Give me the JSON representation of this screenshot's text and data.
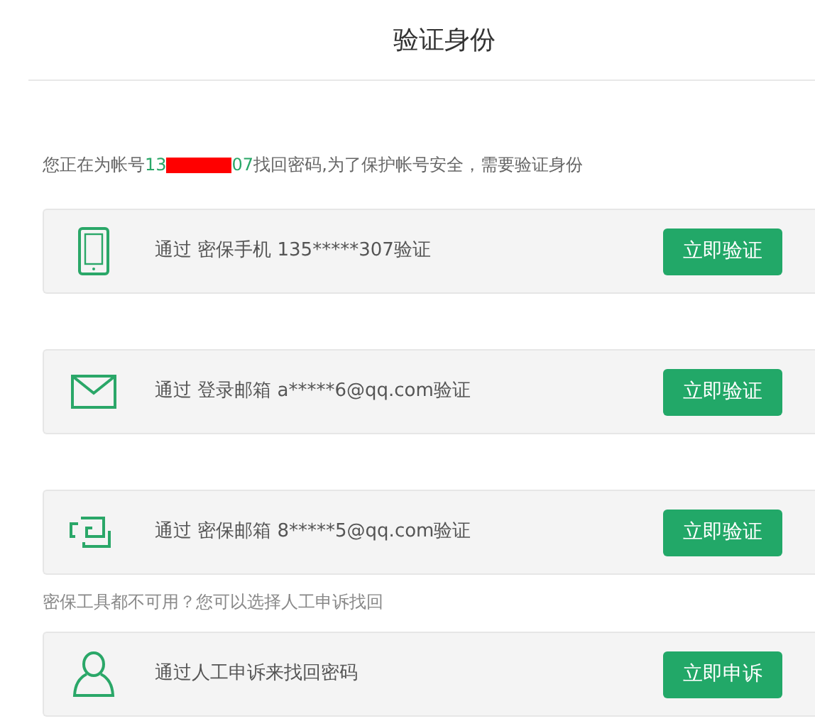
{
  "title": "验证身份",
  "intro": {
    "prefix": "您正在为帐号",
    "account_start": "13",
    "account_end": "07",
    "suffix": "找回密码,为了保护帐号安全，需要验证身份"
  },
  "options": [
    {
      "kind": "phone",
      "text": "通过 密保手机 135*****307验证",
      "button": "立即验证"
    },
    {
      "kind": "mail",
      "text": "通过 登录邮箱 a*****6@qq.com验证",
      "button": "立即验证"
    },
    {
      "kind": "device",
      "text": "通过 密保邮箱 8*****5@qq.com验证",
      "button": "立即验证"
    }
  ],
  "appeal": {
    "note": "密保工具都不可用？您可以选择人工申诉找回",
    "option": {
      "kind": "person",
      "text": "通过人工申诉来找回密码",
      "button": "立即申诉"
    }
  }
}
